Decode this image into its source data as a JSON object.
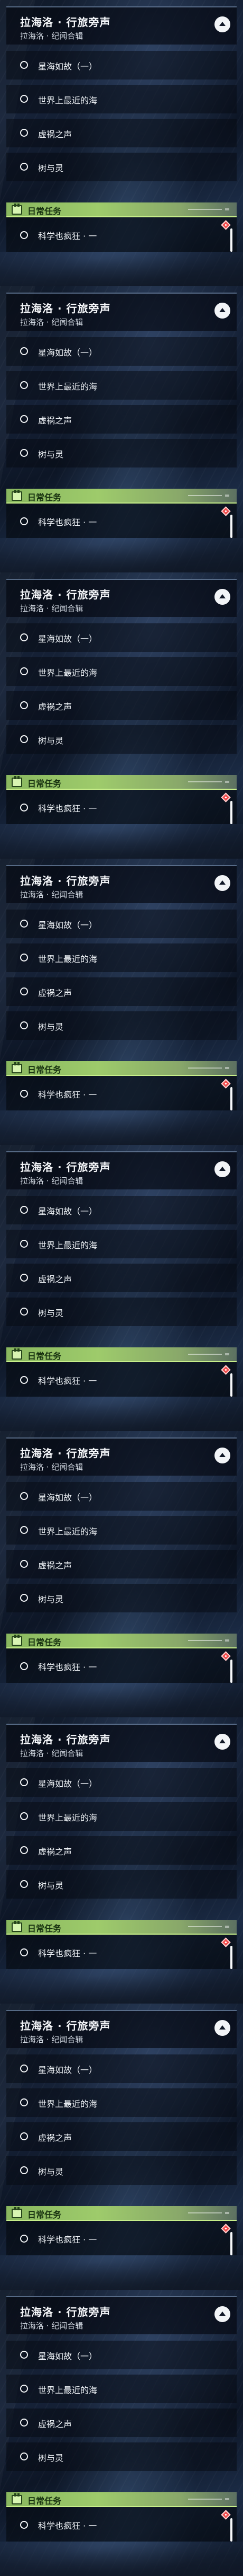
{
  "quest": {
    "title": "拉海洛 · 行旅旁声",
    "subtitle": "拉海洛 · 纪闻合辑"
  },
  "objectives": [
    {
      "label": "星海如故（一）"
    },
    {
      "label": "世界上最近的海"
    },
    {
      "label": "虚祸之声"
    },
    {
      "label": "树与灵"
    }
  ],
  "daily": {
    "title": "日常任务",
    "task_label": "科学也疯狂 · 一"
  },
  "icons": {
    "collapse": "chevron-up-icon",
    "objective": "circle-icon",
    "daily": "calendar-icon",
    "marker": "diamond-icon"
  },
  "colors": {
    "daily_banner": "#9ecb6b",
    "marker": "#f04b4b"
  }
}
